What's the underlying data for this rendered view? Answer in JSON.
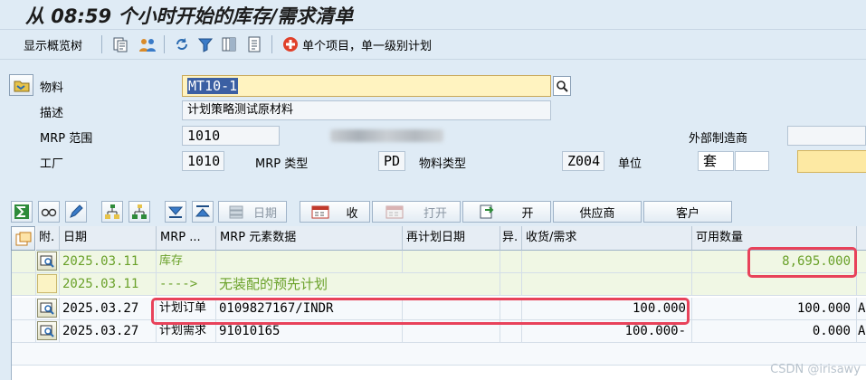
{
  "window": {
    "title": "从 08:59 个小时开始的库存/需求清单"
  },
  "toolbar": {
    "overview_tree_label": "显示概览树",
    "single_item_label": "单个项目，单一级别计划"
  },
  "header": {
    "material_label": "物料",
    "material_value": "MT10-1",
    "description_label": "描述",
    "description_value": "计划策略测试原材料",
    "mrp_area_label": "MRP 范围",
    "mrp_area_value": "1010",
    "plant_label": "工厂",
    "plant_value": "1010",
    "mrp_type_label": "MRP 类型",
    "mrp_type_value": "PD",
    "material_type_label": "物料类型",
    "material_type_value": "Z004",
    "unit_label": "单位",
    "unit_value": "套",
    "external_manufacturer_label": "外部制造商"
  },
  "grid_toolbar": {
    "date_button": "日期",
    "receipt_button": "收",
    "open_button": "打开",
    "open2_button": "开",
    "vendor_button": "供应商",
    "customer_button": "客户"
  },
  "table": {
    "headers": [
      "附.",
      "日期",
      "MRP ...",
      "MRP 元素数据",
      "再计划日期",
      "异.",
      "收货/需求",
      "可用数量"
    ],
    "rows": [
      {
        "date": "2025.03.11",
        "element": "库存",
        "data": "",
        "reschedule": "",
        "exception": "",
        "qty": "",
        "available": "8,695.000",
        "extra": ""
      },
      {
        "date": "2025.03.11",
        "element": "---->",
        "data": "无装配的预先计划",
        "reschedule": "",
        "exception": "",
        "qty": "",
        "available": "",
        "extra": ""
      },
      {
        "date": "2025.03.27",
        "element": "计划订单",
        "data": "0109827167/INDR",
        "reschedule": "",
        "exception": "",
        "qty": "100.000",
        "available": "100.000",
        "extra": "A"
      },
      {
        "date": "2025.03.27",
        "element": "计划需求",
        "data": "91010165",
        "reschedule": "",
        "exception": "",
        "qty": "100.000-",
        "available": "0.000",
        "extra": "A"
      }
    ]
  },
  "watermark": "CSDN @irisawy",
  "colors": {
    "background": "#dfebf5",
    "highlight": "#e8425a",
    "green_text": "#6aa12a",
    "input_yellow": "#fff3c0"
  }
}
